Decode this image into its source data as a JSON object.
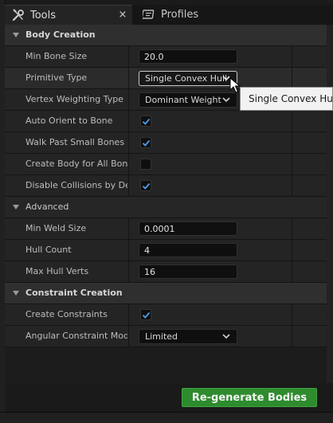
{
  "tabs": [
    {
      "label": "Tools",
      "icon": "wrench-screwdriver-icon",
      "active": true
    },
    {
      "label": "Profiles",
      "icon": "profile-card-icon",
      "active": false
    }
  ],
  "tab_close_glyph": "×",
  "sections": {
    "body_creation": "Body Creation",
    "advanced": "Advanced",
    "constraint_creation": "Constraint Creation"
  },
  "properties": {
    "min_bone_size": {
      "label": "Min Bone Size",
      "value": "20.0"
    },
    "primitive_type": {
      "label": "Primitive Type",
      "value": "Single Convex Hull"
    },
    "vertex_weighting_type": {
      "label": "Vertex Weighting Type",
      "value": "Dominant Weight"
    },
    "auto_orient": {
      "label": "Auto Orient to Bone",
      "checked": true
    },
    "walk_past": {
      "label": "Walk Past Small Bones",
      "checked": true
    },
    "create_body_all": {
      "label": "Create Body for All Bones",
      "checked": false
    },
    "disable_collisions": {
      "label": "Disable Collisions by De...",
      "checked": true
    },
    "min_weld_size": {
      "label": "Min Weld Size",
      "value": "0.0001"
    },
    "hull_count": {
      "label": "Hull Count",
      "value": "4"
    },
    "max_hull_verts": {
      "label": "Max Hull Verts",
      "value": "16"
    },
    "create_constraints": {
      "label": "Create Constraints",
      "checked": true
    },
    "angular_constraint_mode": {
      "label": "Angular Constraint Mode",
      "value": "Limited"
    }
  },
  "tooltip": "Single Convex Hull",
  "regen_button": "Re-generate Bodies",
  "colors": {
    "accent_green": "#2e8b2e",
    "check_blue": "#4a9be6",
    "panel_bg": "#242424"
  }
}
